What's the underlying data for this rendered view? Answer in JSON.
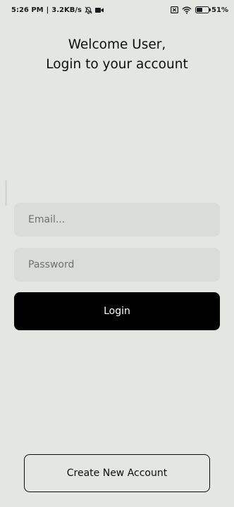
{
  "status_bar": {
    "time": "5:26 PM",
    "separator": "|",
    "net_speed": "3.2KB/s",
    "battery_percent": "51",
    "battery_suffix": "%",
    "icons": [
      "alarm-off-icon",
      "video-camera-icon",
      "sim-off-icon",
      "wifi-icon",
      "battery-icon"
    ]
  },
  "heading": {
    "line1": "Welcome User,",
    "line2": "Login to your account"
  },
  "form": {
    "email_placeholder": "Email...",
    "password_placeholder": "Password",
    "login_label": "Login"
  },
  "footer": {
    "create_account_label": "Create New Account"
  },
  "colors": {
    "background": "#e3e6e1",
    "field_background": "#d9dcd7",
    "primary_button": "#000000",
    "text": "#0e0e0e"
  },
  "battery_level": 0.51
}
